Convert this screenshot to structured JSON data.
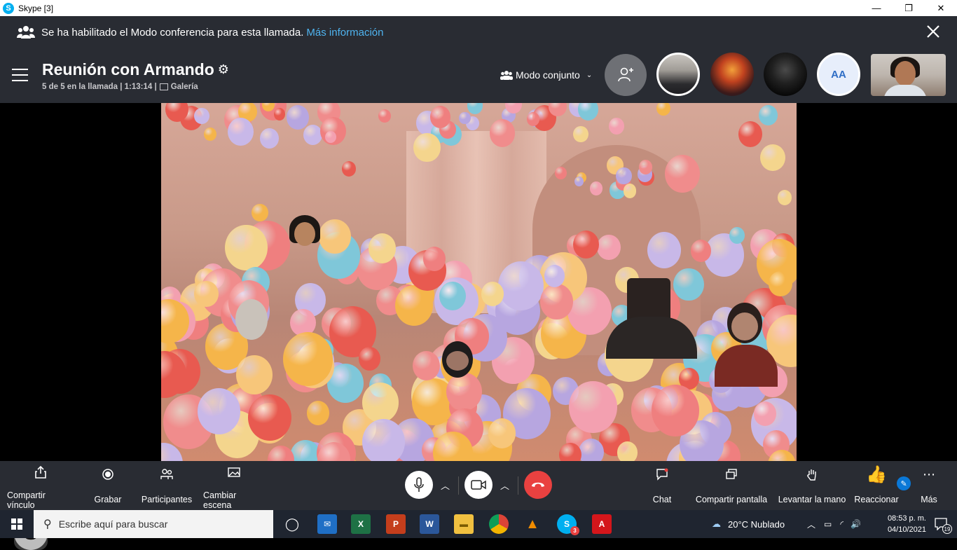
{
  "window": {
    "title": "Skype [3]",
    "minimize": "—",
    "restore": "❐",
    "close": "✕"
  },
  "banner": {
    "message": "Se ha habilitado el Modo conferencia para esta llamada.",
    "link": "Más información"
  },
  "call": {
    "title": "Reunión con Armando",
    "subtitle": "5 de 5 en la llamada | 1:13:14 |",
    "view": "Galería",
    "mode": "Modo conjunto"
  },
  "participants": {
    "initials": "AA"
  },
  "controls": {
    "share_link": "Compartir vínculo",
    "record": "Grabar",
    "participants": "Participantes",
    "change_scene": "Cambiar escena",
    "chat": "Chat",
    "share_screen": "Compartir pantalla",
    "raise_hand": "Levantar la mano",
    "react": "Reaccionar",
    "more": "Más"
  },
  "taskbar": {
    "search_placeholder": "Escribe aquí para buscar",
    "weather": "20°C  Nublado",
    "time": "08:53 p. m.",
    "date": "04/10/2021",
    "notifications": "19",
    "skype_badge": "3"
  },
  "colors": {
    "accent": "#4fb4f0",
    "end_call": "#e94140",
    "bar": "#292c33",
    "skype": "#00aff0"
  }
}
